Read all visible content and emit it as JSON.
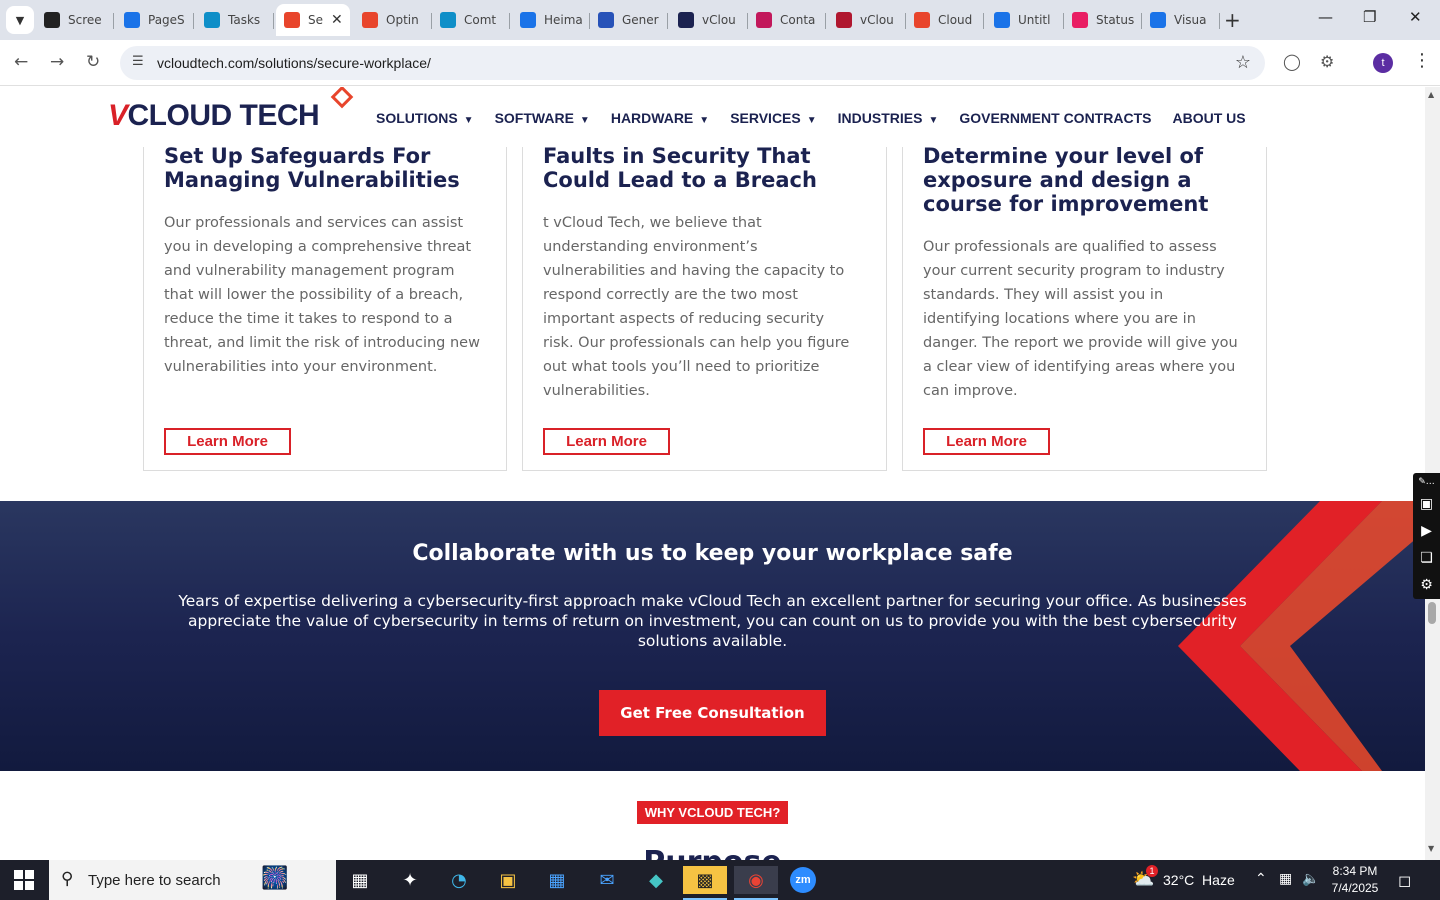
{
  "browser": {
    "tabs": [
      {
        "label": "Scree",
        "icon": "screenshot-app-icon",
        "color": "#222222"
      },
      {
        "label": "PageS",
        "icon": "pagespeed-icon",
        "color": "#1a73e8"
      },
      {
        "label": "Tasks",
        "icon": "tasks-icon",
        "color": "#0f8fc8"
      },
      {
        "label": "Se",
        "icon": "vcloud-icon",
        "color": "#e8452c"
      },
      {
        "label": "Optin",
        "icon": "vcloud-icon",
        "color": "#e8452c"
      },
      {
        "label": "Comt",
        "icon": "clickup-icon",
        "color": "#0f8fc8"
      },
      {
        "label": "Heima",
        "icon": "heimdal-icon",
        "color": "#1a73e8"
      },
      {
        "label": "Gener",
        "icon": "confluence-icon",
        "color": "#2752b8"
      },
      {
        "label": "vClou",
        "icon": "vcloud-check-icon",
        "color": "#1b2250"
      },
      {
        "label": "Conta",
        "icon": "contact-icon",
        "color": "#c2185b"
      },
      {
        "label": "vClou",
        "icon": "vcloud-v-icon",
        "color": "#b0172f"
      },
      {
        "label": "Cloud",
        "icon": "cloud-icon",
        "color": "#e8452c"
      },
      {
        "label": "Untitl",
        "icon": "docs-icon",
        "color": "#1a73e8"
      },
      {
        "label": "Status",
        "icon": "status-icon",
        "color": "#e91e63"
      },
      {
        "label": "Visua",
        "icon": "visual-icon",
        "color": "#1a73e8"
      }
    ],
    "url": "vcloudtech.com/solutions/secure-workplace/"
  },
  "header": {
    "logo_v": "V",
    "logo_rest": "CLOUD TECH",
    "menu": [
      {
        "label": "SOLUTIONS",
        "caret": true
      },
      {
        "label": "SOFTWARE",
        "caret": true
      },
      {
        "label": "HARDWARE",
        "caret": true
      },
      {
        "label": "SERVICES",
        "caret": true
      },
      {
        "label": "INDUSTRIES",
        "caret": true
      },
      {
        "label": "GOVERNMENT CONTRACTS",
        "caret": false
      },
      {
        "label": "ABOUT US",
        "caret": false
      }
    ]
  },
  "cards": [
    {
      "title": "Set Up Safeguards For Managing Vulnerabilities",
      "body": "Our professionals and services can assist you in developing a comprehensive threat and vulnerability management program that will lower the possibility of a breach, reduce the time it takes to respond to a threat, and limit the risk of introducing new vulnerabilities into your environment.",
      "button": "Learn More"
    },
    {
      "title": "Faults in Security That Could Lead to a Breach",
      "body": "t vCloud Tech, we believe that understanding environment’s vulnerabilities and having the capacity to respond correctly are the two most important aspects of reducing security risk. Our professionals can help you figure out what tools you’ll need to prioritize vulnerabilities.",
      "button": "Learn More"
    },
    {
      "title": "Determine your level of exposure and design a course for improvement",
      "body": "Our professionals are qualified to assess your current security program to industry standards. They will assist you in identifying locations where you are in danger. The report we provide will give you a clear view of identifying areas where you can improve.",
      "button": "Learn More"
    }
  ],
  "cta": {
    "heading": "Collaborate with us to keep your workplace safe",
    "text": "Years of expertise delivering a cybersecurity-first approach make vCloud Tech an excellent partner for securing your office. As businesses appreciate the value of cybersecurity in terms of return on investment, you can count on us to provide you with the best cybersecurity solutions available.",
    "button": "Get Free Consultation"
  },
  "why_badge": "WHY VCLOUD TECH?",
  "purpose_heading": "Purpose",
  "taskbar": {
    "search_placeholder": "Type here to search",
    "weather": "32°C  Haze",
    "weather_badge": "1",
    "time": "8:34 PM",
    "date": "7/4/2025"
  },
  "colors": {
    "brand_red": "#e12127",
    "brand_navy": "#1b2250"
  }
}
